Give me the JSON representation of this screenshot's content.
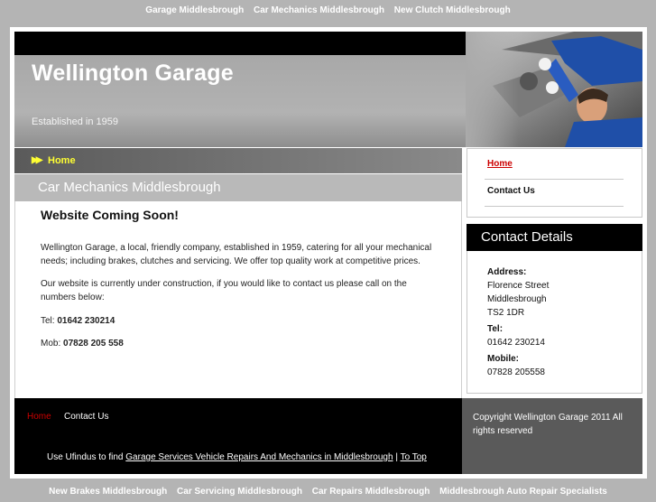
{
  "top_nav": [
    "Garage Middlesbrough",
    "Car Mechanics Middlesbrough",
    "New Clutch Middlesbrough"
  ],
  "header": {
    "title": "Wellington Garage",
    "tagline": "Established in 1959"
  },
  "breadcrumb": {
    "home": "Home"
  },
  "page_heading": "Car Mechanics Middlesbrough",
  "main": {
    "heading": "Website Coming Soon!",
    "para1": "Wellington Garage, a local, friendly company, established in 1959, catering for all your mechanical needs; including brakes, clutches and servicing. We offer top quality work at competitive prices.",
    "para2": "Our website is currently under construction, if you would like to contact us please call on the numbers below:",
    "tel_label": "Tel:",
    "tel": "01642 230214",
    "mob_label": "Mob:",
    "mob": "07828 205 558"
  },
  "side_menu": [
    "Home",
    "Contact Us"
  ],
  "contact": {
    "heading": "Contact Details",
    "address_label": "Address:",
    "address_lines": [
      "Florence Street",
      "Middlesbrough",
      "TS2 1DR"
    ],
    "tel_label": "Tel:",
    "tel": "01642 230214",
    "mobile_label": "Mobile:",
    "mobile": "07828 205558"
  },
  "footer": {
    "links": [
      "Home",
      "Contact Us"
    ],
    "credit_prefix": "Use Ufindus to find",
    "credit_link": "Garage Services Vehicle Repairs And Mechanics in Middlesbrough",
    "separator": "|",
    "to_top": "To Top",
    "copyright": "Copyright Wellington Garage 2011 All rights reserved"
  },
  "bottom_nav": [
    "New Brakes Middlesbrough",
    "Car Servicing Middlesbrough",
    "Car Repairs Middlesbrough",
    "Middlesbrough Auto Repair Specialists"
  ],
  "colors": {
    "page_bg": "#b4b4b4",
    "accent_yellow": "#ffff33",
    "active_red": "#cc0000"
  }
}
